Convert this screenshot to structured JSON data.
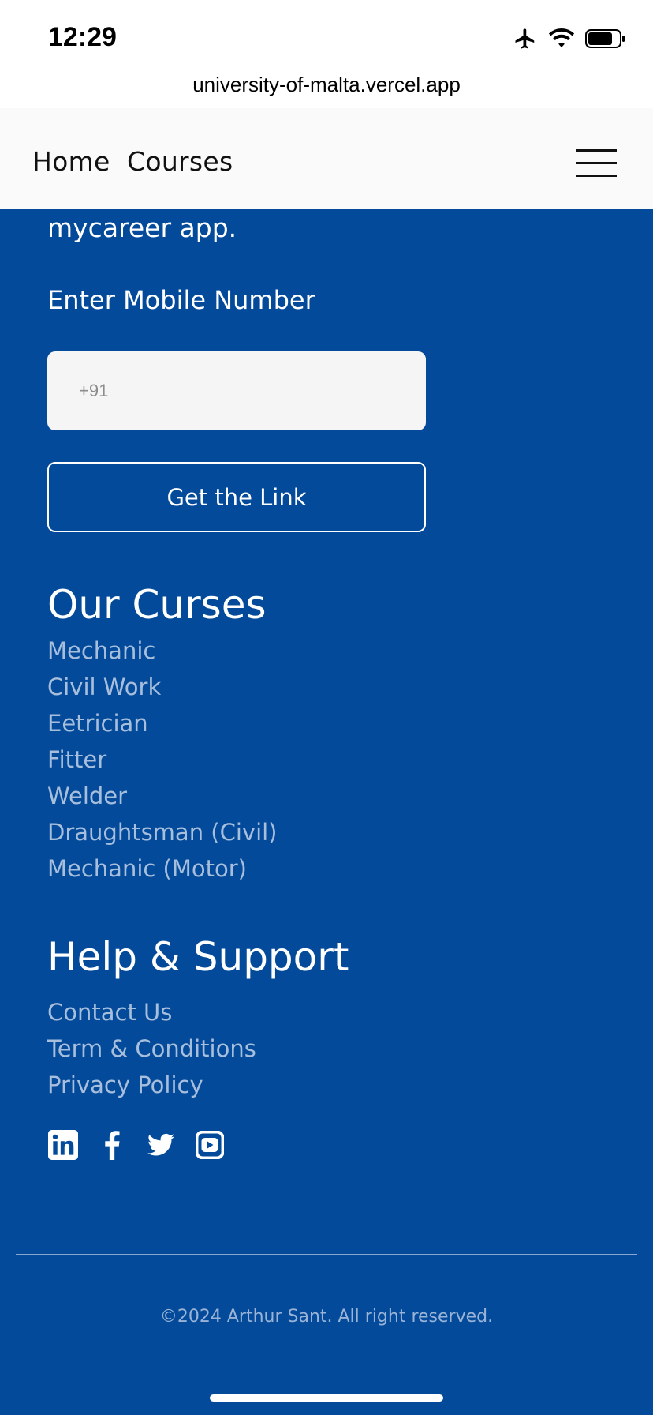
{
  "status": {
    "time": "12:29",
    "url": "university-of-malta.vercel.app",
    "icons": [
      "airplane-icon",
      "wifi-icon",
      "battery-icon"
    ]
  },
  "nav": {
    "links": [
      "Home",
      "Courses"
    ],
    "menu_icon": "hamburger-menu-icon"
  },
  "download": {
    "tail_text": "mycareer app.",
    "label": "Enter Mobile Number",
    "input_placeholder": "+91",
    "button_label": "Get the Link"
  },
  "courses": {
    "title": "Our Curses",
    "items": [
      "Mechanic",
      "Civil Work",
      "Eetrician",
      "Fitter",
      "Welder",
      "Draughtsman (Civil)",
      "Mechanic (Motor)"
    ]
  },
  "support": {
    "title": "Help & Support",
    "items": [
      "Contact Us",
      "Term & Conditions",
      "Privacy Policy"
    ]
  },
  "social": [
    "linkedin-icon",
    "facebook-icon",
    "twitter-icon",
    "youtube-icon"
  ],
  "footer": {
    "copyright": "©2024 Arthur Sant. All right reserved."
  },
  "colors": {
    "background": "#034b9a",
    "link_muted": "#a7bedc",
    "navbar": "#fafafa"
  }
}
